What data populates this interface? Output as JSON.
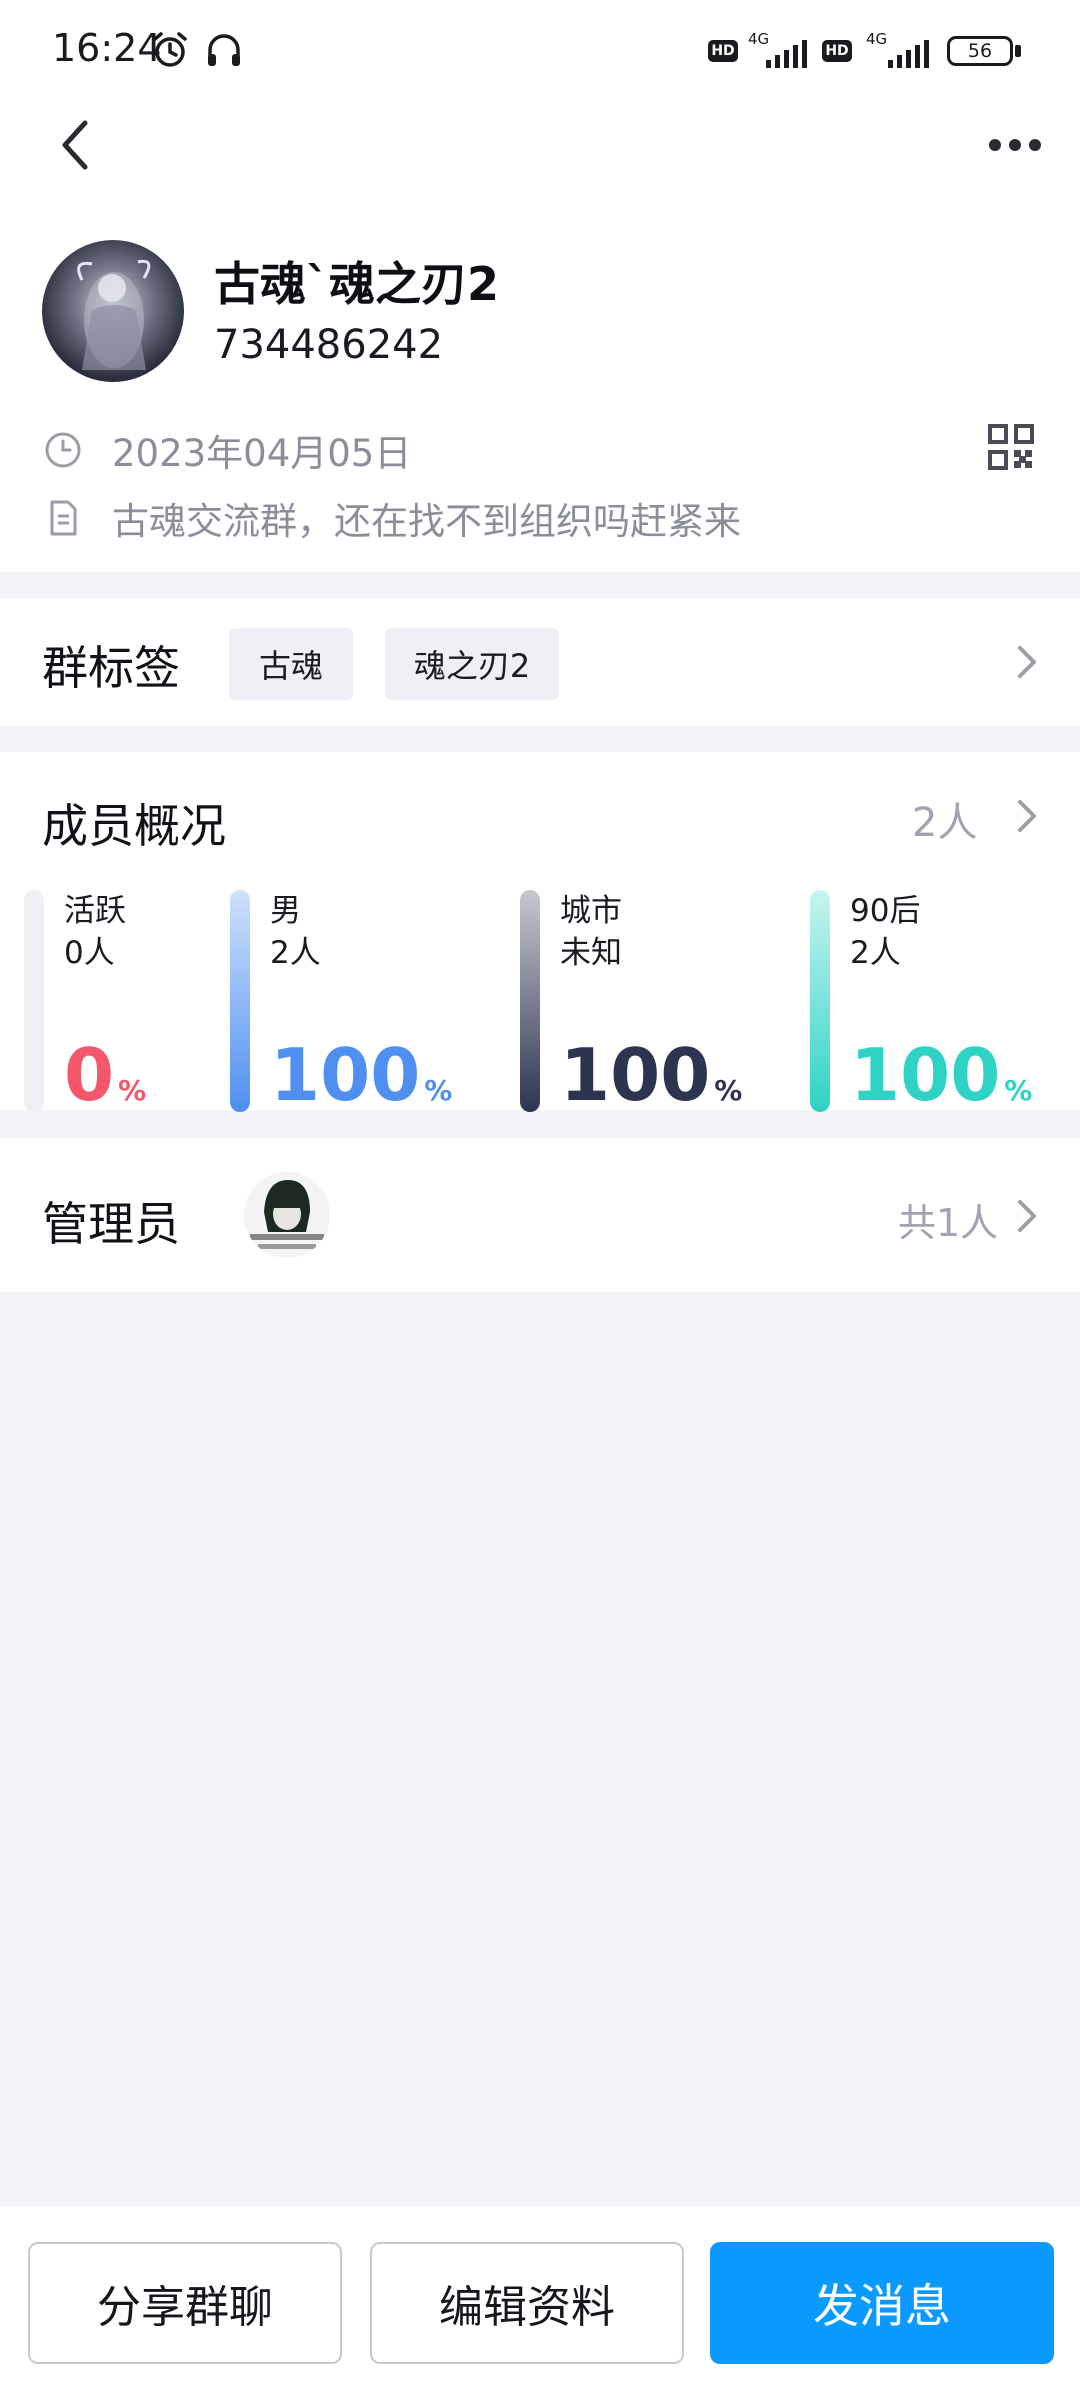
{
  "status_bar": {
    "time": "16:24",
    "sim1_network": "4G",
    "sim2_network": "4G",
    "hd_label": "HD",
    "battery": "56"
  },
  "group": {
    "name": "古魂`魂之刃2",
    "id": "734486242",
    "created_date": "2023年04月05日",
    "description": "古魂交流群，还在找不到组织吗赶紧来"
  },
  "tags": {
    "title": "群标签",
    "items": [
      "古魂",
      "魂之刃2"
    ]
  },
  "members": {
    "title": "成员概况",
    "count": "2人",
    "stats": [
      {
        "label": "活跃",
        "value": "0人",
        "percent": "0",
        "unit": "%",
        "fill": 0,
        "color": "#f4566b"
      },
      {
        "label": "男",
        "value": "2人",
        "percent": "100",
        "unit": "%",
        "fill": 1,
        "color": "#4f8ff0"
      },
      {
        "label": "城市",
        "value": "未知",
        "percent": "100",
        "unit": "%",
        "fill": 1,
        "color": "#2d3450"
      },
      {
        "label": "90后",
        "value": "2人",
        "percent": "100",
        "unit": "%",
        "fill": 1,
        "color": "#2ed3c5"
      }
    ]
  },
  "admin": {
    "title": "管理员",
    "total": "共1人"
  },
  "actions": {
    "share": "分享群聊",
    "edit": "编辑资料",
    "send": "发消息"
  },
  "colors": {
    "primary": "#0a99ff",
    "background": "#f3f4f8",
    "muted_text": "#8b8e99"
  }
}
